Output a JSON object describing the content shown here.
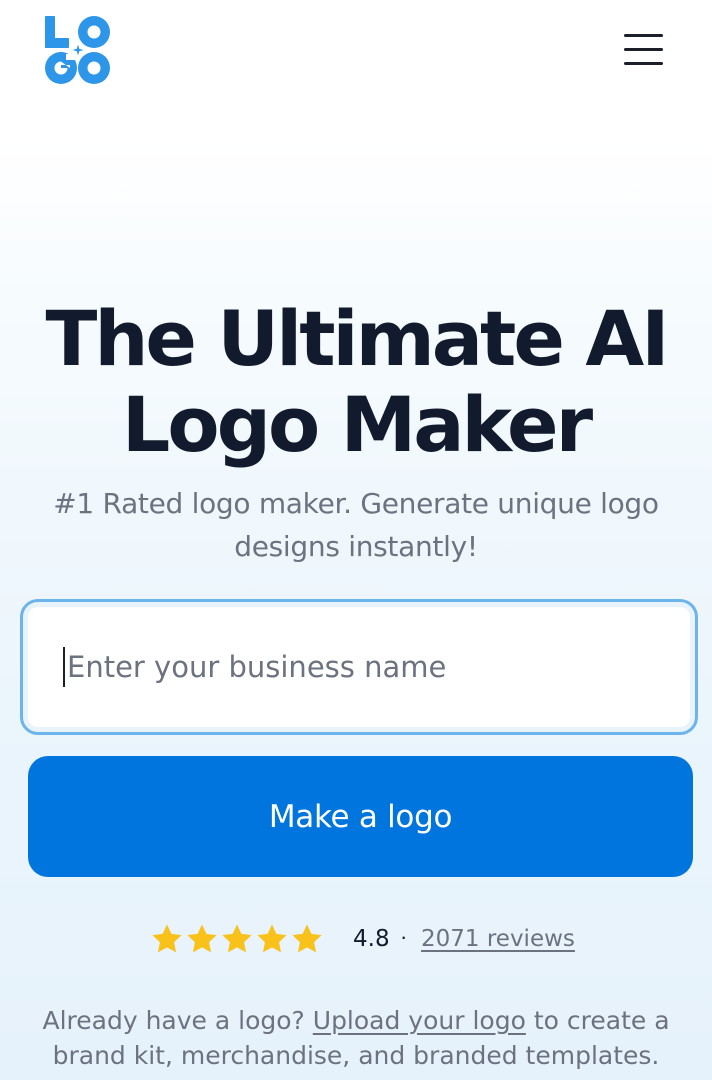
{
  "header": {
    "logo_text": "LOGO",
    "menu_icon": "hamburger-menu-icon"
  },
  "hero": {
    "title_line1": "The Ultimate AI",
    "title_line2": "Logo Maker",
    "subtitle": "#1 Rated logo maker. Generate unique logo designs instantly!"
  },
  "search": {
    "placeholder": "Enter your business name",
    "value": ""
  },
  "cta": {
    "label": "Make a logo"
  },
  "rating": {
    "stars": 5,
    "score": "4.8",
    "separator": "·",
    "reviews_label": "2071 reviews"
  },
  "upload": {
    "prefix": "Already have a logo?",
    "link_label": "Upload your logo",
    "suffix": "to create a brand kit, merchandise, and branded templates."
  },
  "colors": {
    "brand_blue": "#0075dd",
    "logo_blue": "#2e96e8",
    "star_yellow": "#f9c21b",
    "title_dark": "#121a2e",
    "muted_gray": "#6c7280",
    "input_focus": "#6cb4ec"
  }
}
